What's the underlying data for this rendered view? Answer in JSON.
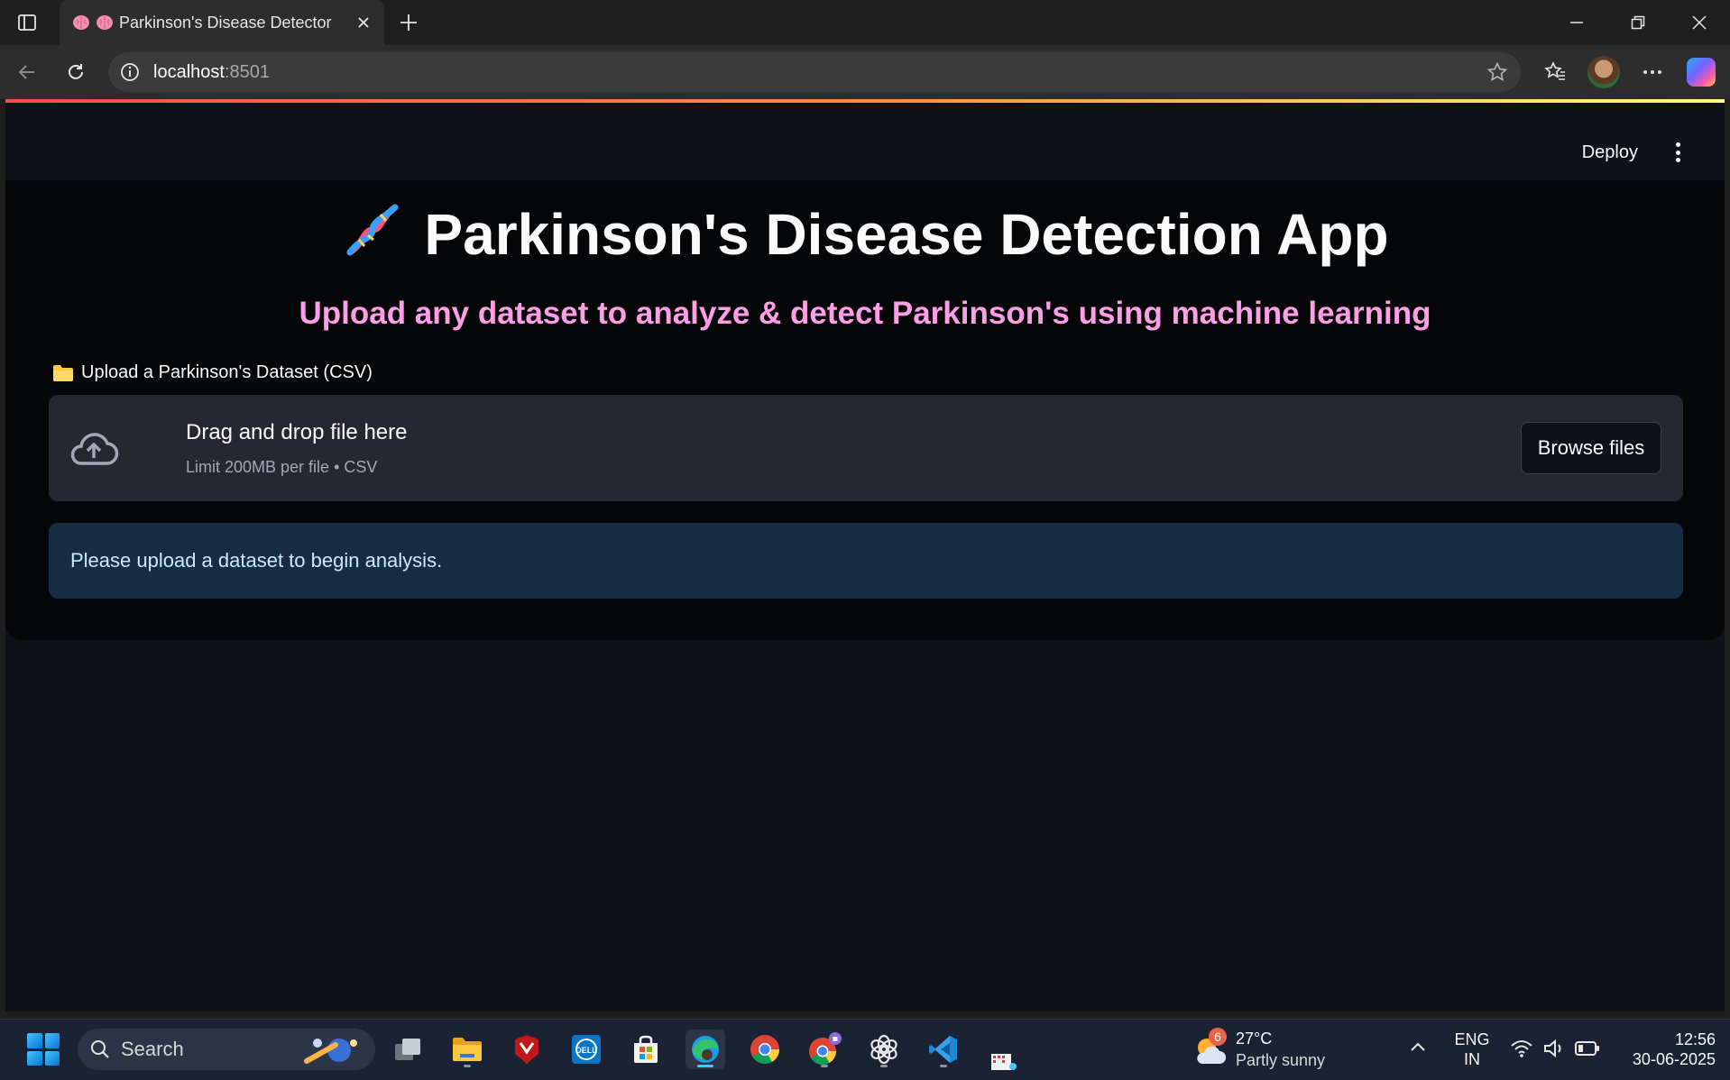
{
  "browser": {
    "tab_title": "Parkinson's Disease Detector",
    "url_host": "localhost",
    "url_port": ":8501"
  },
  "app": {
    "deploy_label": "Deploy",
    "title": "Parkinson's Disease Detection App",
    "subtitle": "Upload any dataset to analyze & detect Parkinson's using machine learning",
    "upload_label": "Upload a Parkinson's Dataset (CSV)",
    "dropzone_title": "Drag and drop file here",
    "dropzone_limit": "Limit 200MB per file • CSV",
    "browse_label": "Browse files",
    "info_message": "Please upload a dataset to begin analysis.",
    "colors": {
      "accent_subtitle": "#ff9de6",
      "info_bg": "#172d43",
      "page_bg": "#0e1117"
    }
  },
  "taskbar": {
    "search_placeholder": "Search",
    "weather_badge": "6",
    "weather_temp": "27°C",
    "weather_condition": "Partly sunny",
    "lang_top": "ENG",
    "lang_bottom": "IN",
    "time": "12:56",
    "date": "30-06-2025",
    "apps": [
      "task-view-icon",
      "file-explorer-icon",
      "mcafee-icon",
      "dell-icon",
      "microsoft-store-icon",
      "edge-icon",
      "chrome-icon",
      "chrome-profile-icon",
      "chatgpt-icon",
      "vscode-icon",
      "snipping-icon"
    ]
  }
}
